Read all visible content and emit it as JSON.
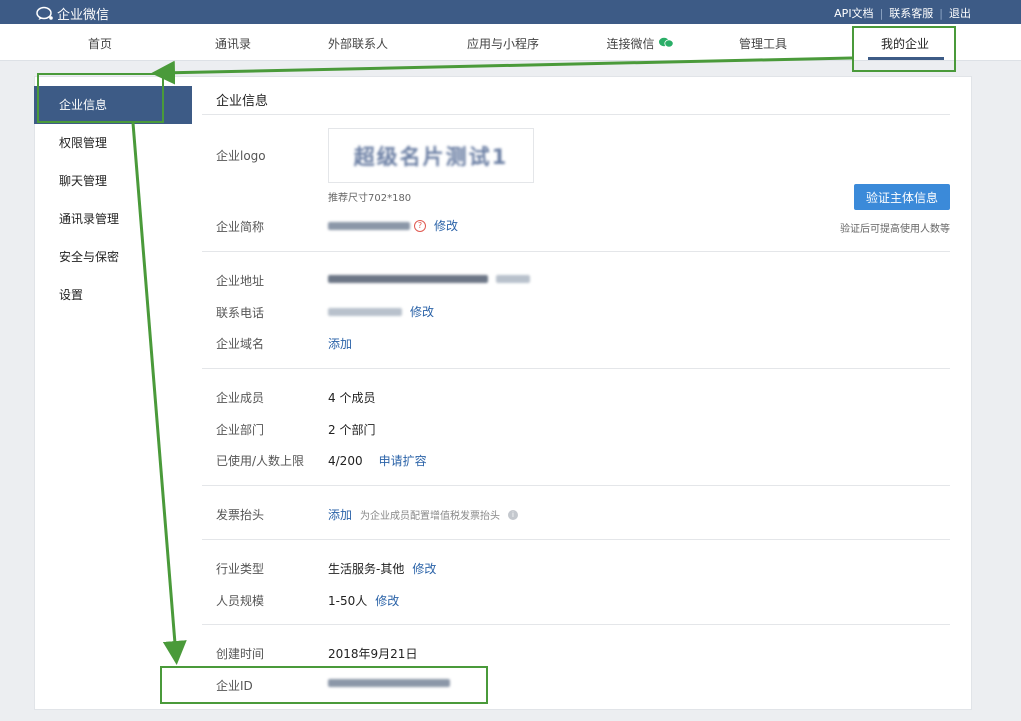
{
  "topbar": {
    "app_name": "企业微信",
    "links": [
      "API文档",
      "联系客服",
      "退出"
    ],
    "separator": "|"
  },
  "nav": {
    "items": [
      "首页",
      "通讯录",
      "外部联系人",
      "应用与小程序",
      "连接微信",
      "管理工具",
      "我的企业"
    ],
    "active": "我的企业"
  },
  "sidebar": {
    "items": [
      "企业信息",
      "权限管理",
      "聊天管理",
      "通讯录管理",
      "安全与保密",
      "设置"
    ],
    "active": "企业信息"
  },
  "content": {
    "title": "企业信息",
    "logo_label": "企业logo",
    "logo_text": "超级名片测试1",
    "logo_size_hint": "推荐尺寸702*180",
    "verify_button": "验证主体信息",
    "verify_hint": "验证后可提高使用人数等",
    "short_name_label": "企业简称",
    "modify": "修改",
    "add": "添加",
    "address_label": "企业地址",
    "phone_label": "联系电话",
    "domain_label": "企业域名",
    "members_label": "企业成员",
    "members_value": "4 个成员",
    "departments_label": "企业部门",
    "departments_value": "2 个部门",
    "limit_label": "已使用/人数上限",
    "limit_value": "4/200",
    "expand_link": "申请扩容",
    "invoice_label": "发票抬头",
    "invoice_hint": "为企业成员配置增值税发票抬头",
    "industry_label": "行业类型",
    "industry_value": "生活服务-其他",
    "scale_label": "人员规模",
    "scale_value": "1-50人",
    "created_label": "创建时间",
    "created_value": "2018年9月21日",
    "id_label": "企业ID"
  },
  "colors": {
    "topbar": "#3d5b86",
    "active_sidebar": "#3d5b86",
    "link": "#2b63a8",
    "button": "#3b8ad9",
    "annotation": "#4a9a3a",
    "wechat_green": "#2aae67"
  }
}
